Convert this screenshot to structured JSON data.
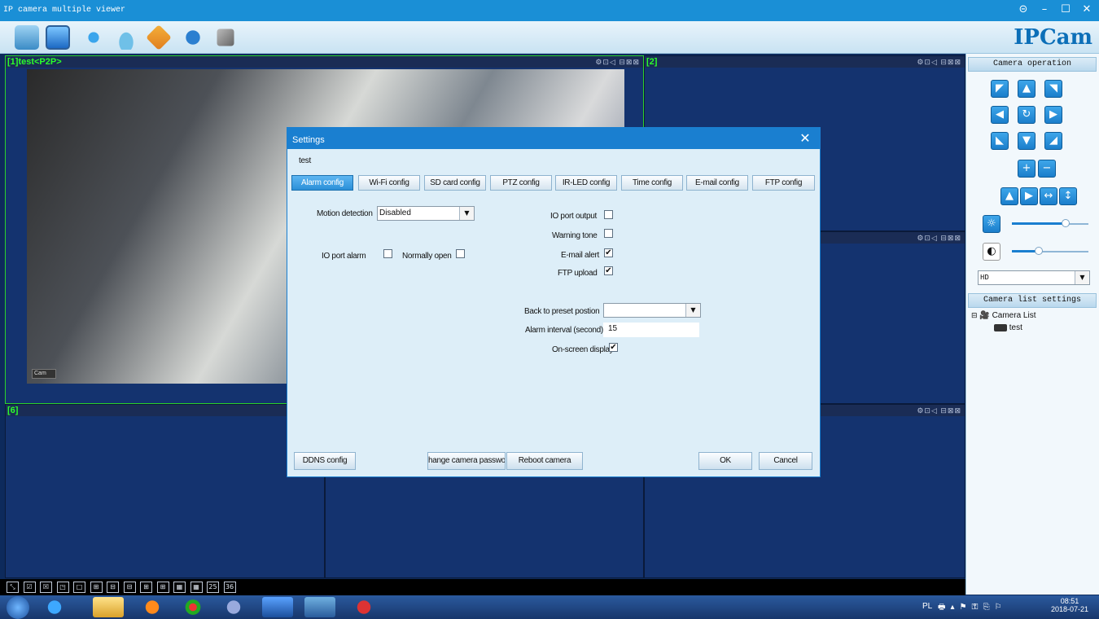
{
  "app": {
    "title": "IP camera multiple viewer",
    "brand": "IPCam",
    "window_controls": [
      "⊝",
      "–",
      "☐",
      "✕"
    ],
    "toolbar_icons": [
      "display-settings-icon",
      "monitor-icon",
      "ptz-control-icon",
      "camera-icon",
      "network-icon",
      "search-user-icon",
      "tools-icon"
    ]
  },
  "panes": [
    {
      "label": "[1]test<P2P>",
      "icons": "⚙⊡◁ ⊟⊠⊠",
      "overlay": "Cam"
    },
    {
      "label": "[2]",
      "icons": "⚙⊡◁ ⊟⊠⊠"
    },
    {
      "label": "",
      "icons": "⚙⊡◁ ⊟⊠⊠"
    },
    {
      "label": "[6]",
      "icons": "⚙⊡"
    },
    {
      "label": "",
      "icons": "⚙⊡◁ ⊟⊠⊠"
    }
  ],
  "right_panel": {
    "camera_operation_header": "Camera operation",
    "resolution_value": "HD",
    "brightness_level": 0.7,
    "contrast_level": 0.35,
    "camera_list_header": "Camera list settings",
    "tree_root": "Camera List",
    "tree_child": "test"
  },
  "layout_bar": [
    "⤡",
    "☑",
    "☒",
    "◳",
    "□",
    "⊞",
    "⊟",
    "⊟",
    "⊞",
    "⊞",
    "▦",
    "▦",
    "25",
    "36"
  ],
  "dialog": {
    "title": "Settings",
    "close": "✕",
    "camera_name": "test",
    "tabs": [
      "Alarm config",
      "Wi-Fi config",
      "SD card config",
      "PTZ config",
      "IR-LED config",
      "Time config",
      "E-mail config",
      "FTP config"
    ],
    "motion_detection_label": "Motion detection",
    "motion_detection_value": "Disabled",
    "io_port_alarm_label": "IO port alarm",
    "normally_open_label": "Normally open",
    "io_port_output_label": "IO port output",
    "warning_tone_label": "Warning tone",
    "email_alert_label": "E-mail alert",
    "ftp_upload_label": "FTP upload",
    "checkboxes": {
      "io_port_alarm": false,
      "normally_open": false,
      "io_port_output": false,
      "warning_tone": false,
      "email_alert": true,
      "ftp_upload": true,
      "on_screen_display": true
    },
    "check_mark": "✔",
    "back_to_preset_label": "Back to preset postion",
    "back_to_preset_value": "",
    "alarm_interval_label": "Alarm interval (second)",
    "alarm_interval_value": "15",
    "on_screen_display_label": "On-screen display",
    "buttons": {
      "ddns": "DDNS config",
      "change_password": "hange camera passwor",
      "reboot": "Reboot camera",
      "ok": "OK",
      "cancel": "Cancel"
    }
  },
  "taskbar": {
    "lang": "PL",
    "time": "08:51",
    "date": "2018-07-21",
    "apps": [
      "ie-icon",
      "explorer-icon",
      "media-icon",
      "chrome-icon",
      "network-tool-icon",
      "save-icon",
      "computer-icon",
      "app-icon"
    ]
  },
  "colors": {
    "accent": "#1a7fd0",
    "pane_bg": "#14336f",
    "pane_label": "#2bff2b"
  }
}
